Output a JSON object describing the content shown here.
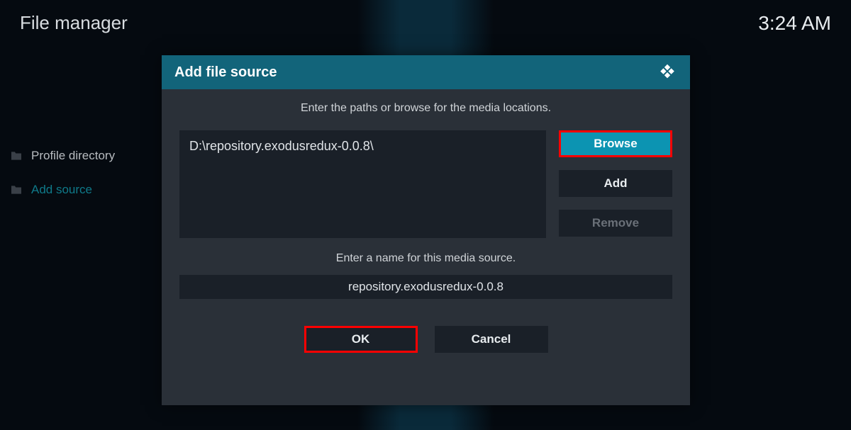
{
  "header": {
    "title": "File manager",
    "time": "3:24 AM"
  },
  "sidebar": {
    "items": [
      {
        "label": "Profile directory",
        "active": false
      },
      {
        "label": "Add source",
        "active": true
      }
    ]
  },
  "dialog": {
    "title": "Add file source",
    "instruction_paths": "Enter the paths or browse for the media locations.",
    "path_value": "D:\\repository.exodusredux-0.0.8\\",
    "buttons": {
      "browse": "Browse",
      "add": "Add",
      "remove": "Remove"
    },
    "instruction_name": "Enter a name for this media source.",
    "name_value": "repository.exodusredux-0.0.8",
    "actions": {
      "ok": "OK",
      "cancel": "Cancel"
    }
  }
}
